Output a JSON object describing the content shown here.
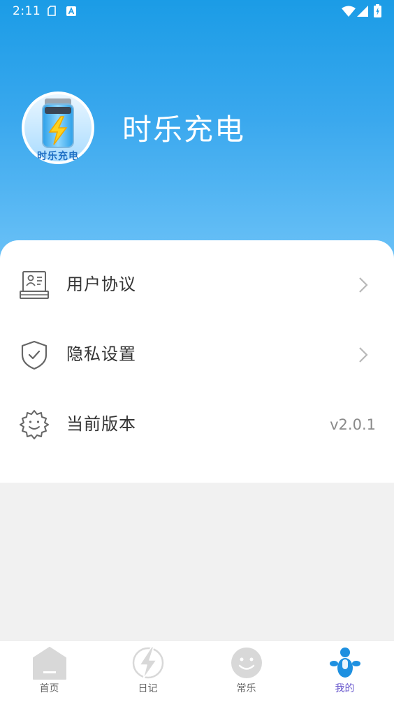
{
  "status_bar": {
    "time": "2:11",
    "icons": [
      "clipboard-icon",
      "a-icon",
      "wifi-icon",
      "signal-icon",
      "battery-charging-icon"
    ]
  },
  "profile": {
    "app_name": "时乐充电",
    "avatar_label": "时乐充电",
    "avatar_icon": "battery-lightning-icon"
  },
  "menu": {
    "items": [
      {
        "label": "用户协议",
        "icon": "id-card-icon",
        "has_chevron": true
      },
      {
        "label": "隐私设置",
        "icon": "shield-check-icon",
        "has_chevron": true
      },
      {
        "label": "当前版本",
        "icon": "gear-smile-icon",
        "value": "v2.0.1"
      }
    ]
  },
  "tabbar": {
    "tabs": [
      {
        "label": "首页",
        "icon": "home-icon",
        "active": false
      },
      {
        "label": "日记",
        "icon": "lightning-icon",
        "active": false
      },
      {
        "label": "常乐",
        "icon": "smiley-icon",
        "active": false
      },
      {
        "label": "我的",
        "icon": "person-icon",
        "active": true
      }
    ]
  },
  "colors": {
    "header_top": "#1b9ce6",
    "header_bottom": "#6cc2f7",
    "active_tab_icon": "#1e90e0",
    "active_tab_label": "#6a5acd",
    "inactive_tab": "#d8d8d8"
  }
}
